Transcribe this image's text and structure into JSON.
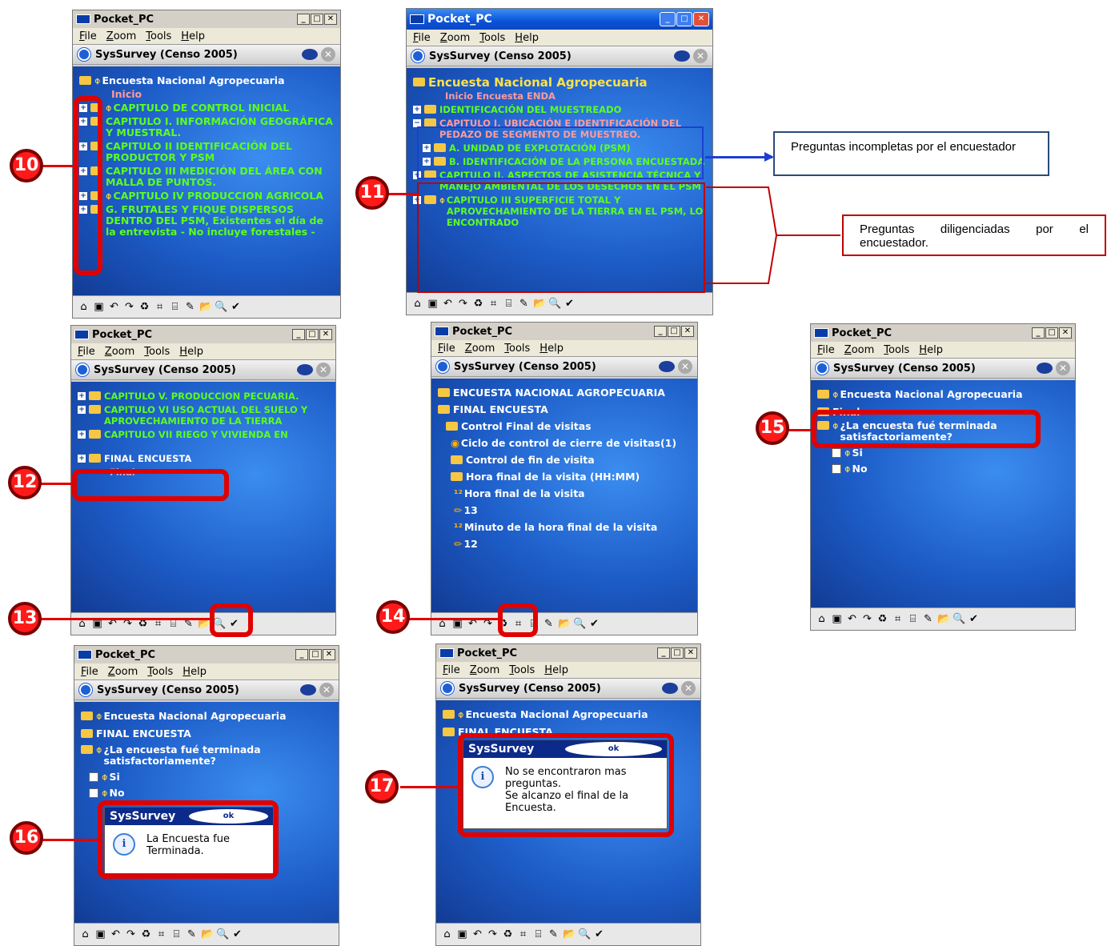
{
  "common": {
    "title": "Pocket_PC",
    "menu": [
      "File",
      "Zoom",
      "Tools",
      "Help"
    ],
    "app": "SysSurvey  (Censo 2005)",
    "min": "_",
    "max": "□",
    "close": "✕",
    "ok": "ok",
    "info": "i"
  },
  "toolbar_icons": [
    "⌂",
    "▣",
    "↶",
    "↷",
    "♻",
    "⌗",
    "⌸",
    "✎",
    "📂",
    "🔍",
    "✔"
  ],
  "s1": {
    "items": [
      "Encuesta Nacional Agropecuaria",
      "Inicio",
      "CAPITULO  DE CONTROL  INICIAL",
      "CAPITULO I. INFORMACIÓN GEOGRÁFICA Y MUESTRAL.",
      "CAPITULO II  IDENTIFICACIÓN DEL PRODUCTOR Y PSM",
      "CAPITULO III MEDICIÓN DEL ÁREA CON MALLA DE PUNTOS.",
      "CAPITULO IV PRODUCCION AGRICOLA",
      "G. FRUTALES Y FIQUE DISPERSOS DENTRO DEL PSM, Existentes el día de la entrevista  - No incluye forestales -"
    ]
  },
  "s2": {
    "items": [
      "Encuesta Nacional Agropecuaria",
      "Inicio Encuesta ENDA",
      "IDENTIFICACIÓN DEL MUESTREADO",
      "CAPITULO I. UBICACIÓN E IDENTIFICACIÓN DEL PEDAZO DE SEGMENTO DE MUESTREO.",
      "A. UNIDAD DE EXPLOTACIÓN (PSM)",
      "B. IDENTIFICACIÓN DE LA PERSONA ENCUESTADA",
      "CAPITULO II. ASPECTOS DE ASISTENCIA TÉCNICA Y MANEJO AMBIENTAL DE LOS DESECHOS EN EL PSM",
      "CAPITULO III  SUPERFICIE TOTAL Y APROVECHAMIENTO DE LA TIERRA EN EL PSM, LO ENCONTRADO"
    ]
  },
  "s3": {
    "items": [
      "CAPITULO V. PRODUCCION PECUARIA.",
      "CAPITULO VI  USO ACTUAL DEL SUELO Y APROVECHAMIENTO DE LA TIERRA",
      "CAPITULO VII RIEGO Y VIVIENDA EN",
      "FINAL ENCUESTA",
      "Final"
    ]
  },
  "s4": {
    "items": [
      "ENCUESTA NACIONAL AGROPECUARIA",
      "FINAL ENCUESTA",
      "Control  Final de visitas",
      "Ciclo  de control  de cierre de visitas(1)",
      "Control  de fin de visita",
      "Hora final  de la visita (HH:MM)",
      "Hora final de la visita",
      "13",
      "Minuto de la hora final de la visita",
      "12"
    ]
  },
  "s5": {
    "items": [
      "Encuesta Nacional Agropecuaria",
      "Final",
      "¿La encuesta fué terminada satisfactoriamente?",
      "Si",
      "No"
    ]
  },
  "s6": {
    "items": [
      "Encuesta Nacional Agropecuaria",
      "FINAL ENCUESTA",
      "¿La encuesta fué terminada satisfactoriamente?",
      "Si",
      "No"
    ],
    "dlg_title": "SysSurvey",
    "dlg_text": "La Encuesta fue Terminada."
  },
  "s7": {
    "items": [
      "Encuesta Nacional Agropecuaria",
      "FINAL ENCUESTA"
    ],
    "dlg_title": "SysSurvey",
    "dlg_text": "No se encontraron mas preguntas.\nSe alcanzo el final de la Encuesta."
  },
  "notes": {
    "incomplete": "Preguntas incompletas por el encuestador",
    "done": "Preguntas   diligenciadas   por   el encuestador."
  },
  "badges": [
    "10",
    "11",
    "12",
    "13",
    "14",
    "15",
    "16",
    "17"
  ]
}
